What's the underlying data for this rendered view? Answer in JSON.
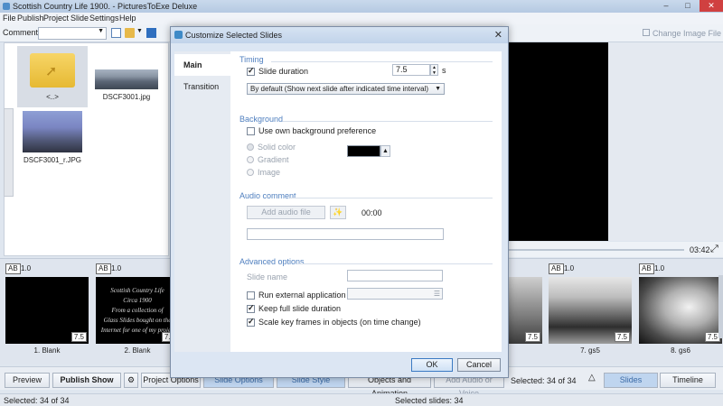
{
  "window": {
    "title": "Scottish Country Life 1900. - PicturesToExe Deluxe"
  },
  "menu": [
    "File",
    "Publish",
    "Project",
    "Slide",
    "Settings",
    "Help"
  ],
  "toolbar": {
    "comment_label": "Comment",
    "comment_value": "",
    "change_image_label": "Change Image File"
  },
  "files": [
    {
      "label": "<..>"
    },
    {
      "label": "DSCF3001.jpg"
    },
    {
      "label": "DSCF3001_r.JPG"
    }
  ],
  "preview": {
    "time": "03:42"
  },
  "slides": [
    {
      "ab": "AB",
      "value": "1.0",
      "title": "1. Blank",
      "duration": "7.5"
    },
    {
      "ab": "AB",
      "value": "1.0",
      "title": "2. Blank",
      "duration": "7.5",
      "text": [
        "Scottish Country Life",
        "Circa 1900",
        "From a collection of",
        "Glass Slides bought on the",
        "Internet for one of my projec"
      ]
    },
    {
      "ab": "AB",
      "value": "1.0",
      "title": "7. gs5",
      "duration": "7.5"
    },
    {
      "ab": "AB",
      "value": "1.0",
      "title": "8. gs6",
      "duration": "7.5"
    },
    {
      "duration": "7.5"
    }
  ],
  "bottom": {
    "preview": "Preview",
    "publish": "Publish Show",
    "project_options": "Project Options",
    "slide_options": "Slide Options",
    "slide_style": "Slide Style",
    "objects": "Objects and Animation",
    "add_audio": "Add Audio or Voice",
    "selected_main": "Selected: 34 of 34",
    "slides_tab": "Slides",
    "timeline_tab": "Timeline"
  },
  "status": {
    "left": "Selected: 34 of 34",
    "center": "Selected slides: 34"
  },
  "dialog": {
    "title": "Customize Selected Slides",
    "nav": {
      "main": "Main",
      "transition": "Transition"
    },
    "timing": {
      "section": "Timing",
      "slide_duration_label": "Slide duration",
      "slide_duration_checked": true,
      "duration_value": "7.5",
      "unit": "s",
      "mode": "By default (Show next slide after indicated time interval)"
    },
    "background": {
      "section": "Background",
      "use_own_label": "Use own background preference",
      "use_own_checked": false,
      "solid": "Solid color",
      "gradient": "Gradient",
      "image": "Image",
      "color": "#000000"
    },
    "audio": {
      "section": "Audio comment",
      "add_label": "Add audio file",
      "time": "00:00",
      "file_value": ""
    },
    "advanced": {
      "section": "Advanced options",
      "slide_name_label": "Slide name",
      "slide_name_value": "",
      "run_external_label": "Run external application",
      "run_external_checked": false,
      "keep_full_label": "Keep full slide duration",
      "keep_full_checked": true,
      "scale_label": "Scale key frames in objects (on time change)",
      "scale_checked": true
    },
    "ok": "OK",
    "cancel": "Cancel"
  }
}
